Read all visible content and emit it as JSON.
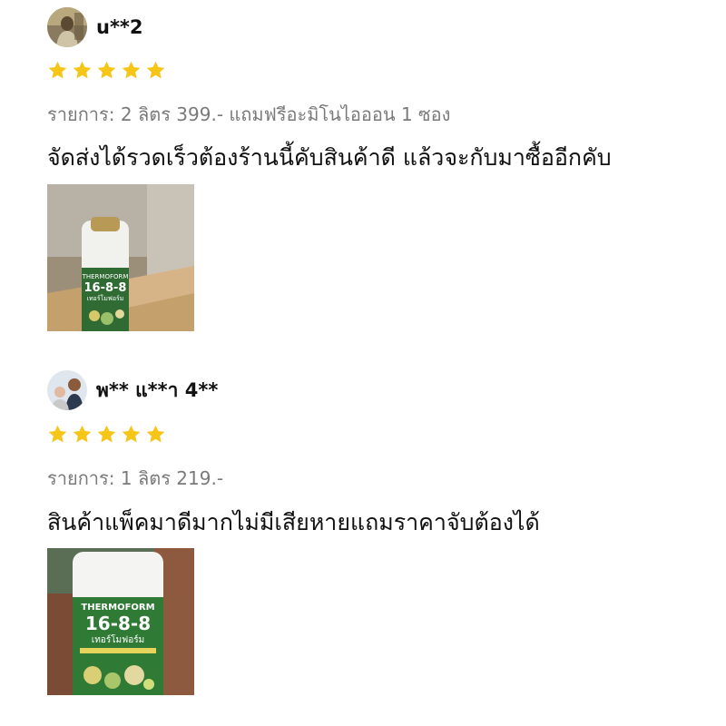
{
  "reviews": [
    {
      "username": "u**2",
      "rating": 5,
      "item": "รายการ: 2 ลิตร 399.- แถมฟรีอะมิโนไอออน 1 ซอง",
      "comment": "จัดส่งได้รวดเร็วต้องร้านนี้คับสินค้าดี แล้วจะกับมาซื้ออีกคับ",
      "photo_text": {
        "brand": "THERMOFORM",
        "grade": "16-8-8",
        "thai": "เทอร์โมฟอร์ม"
      }
    },
    {
      "username": "พ** แ**า 4**",
      "rating": 5,
      "item": "รายการ: 1 ลิตร 219.-",
      "comment": "สินค้าแพ็คมาดีมากไม่มีเสียหายแถมราคาจับต้องได้",
      "photo_text": {
        "brand": "THERMOFORM",
        "grade": "16-8-8",
        "thai": "เทอร์โมฟอร์ม"
      }
    }
  ],
  "colors": {
    "star": "#f5c518",
    "item_text": "#7a7a7a",
    "comment_text": "#111111"
  }
}
